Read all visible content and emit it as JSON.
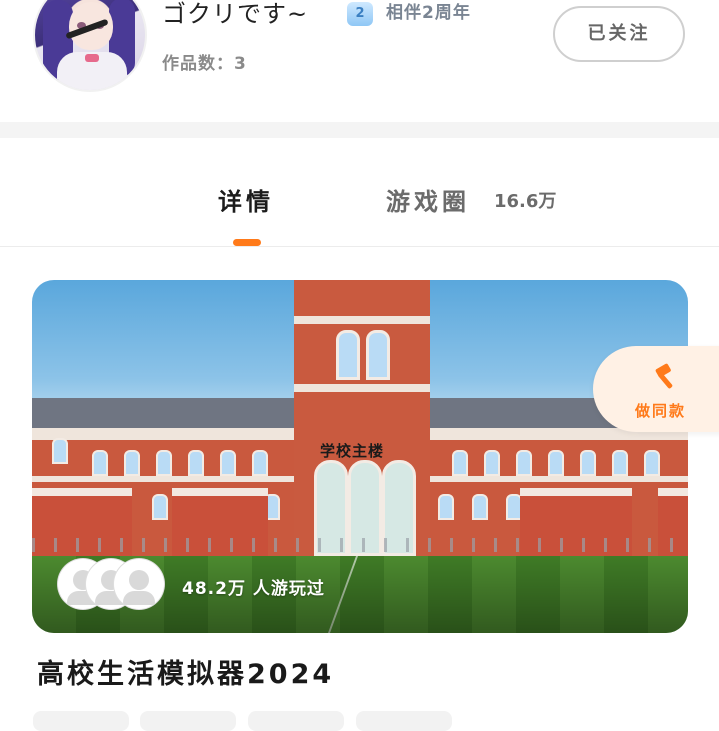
{
  "profile": {
    "username": "ゴクリです~",
    "level": "2",
    "companion_text": "相伴2周年",
    "works_count": "作品数：3",
    "follow_label": "已关注"
  },
  "tabs": {
    "details": "详情",
    "circle": "游戏圈",
    "circle_count": "16.6万"
  },
  "game": {
    "sign_text": "学校主楼",
    "played_text": "48.2万 人游玩过",
    "title": "高校生活模拟器2024",
    "make_same_label": "做同款"
  },
  "colors": {
    "accent": "#ff7a1a",
    "accent_bg": "#fff1e5"
  }
}
